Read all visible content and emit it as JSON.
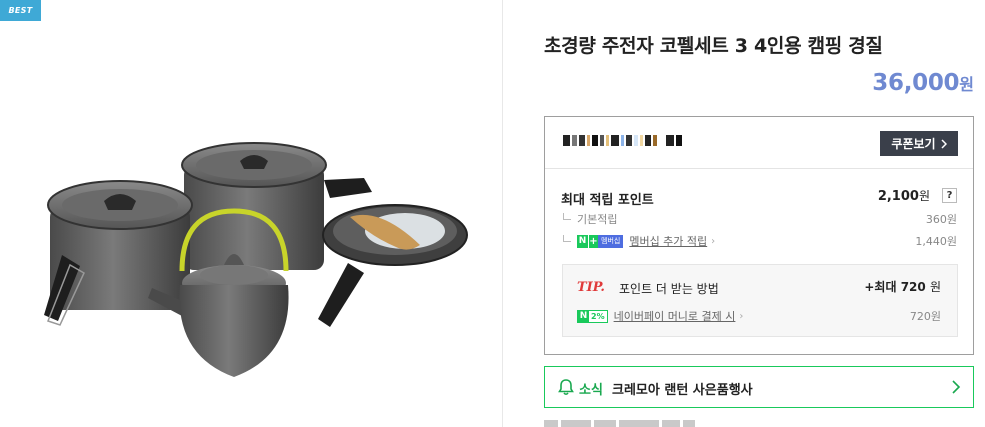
{
  "badge": {
    "label": "BEST"
  },
  "product": {
    "title": "초경량 주전자 코펠세트 3 4인용 캠핑 경질",
    "price": "36,000",
    "price_unit": "원"
  },
  "seller": {
    "coupon_label": "쿠폰보기"
  },
  "points": {
    "max_label": "최대 적립 포인트",
    "max_value": "2,100",
    "max_unit": "원",
    "help_label": "?",
    "basic_label": "기본적립",
    "basic_value": "360원",
    "membership_badge": "멤버십",
    "membership_label": "멤버십 추가 적립",
    "membership_value": "1,440원"
  },
  "tip": {
    "label": "TIP.",
    "text": "포인트 더 받는 방법",
    "value_prefix": "+최대",
    "value": "720",
    "unit": "원",
    "pay_badge": "2%",
    "pay_label": "네이버페이 머니로 결제 시",
    "pay_value": "720원"
  },
  "news": {
    "tag": "소식",
    "text": "크레모아 랜턴 사은품행사"
  },
  "icons": {
    "bell": "bell-icon",
    "chevron": "chevron-right-icon"
  },
  "colors": {
    "price": "#6f89d1",
    "naver_green": "#19c95b",
    "tip_red": "#e03a3a",
    "badge_blue": "#3fa9d6"
  }
}
